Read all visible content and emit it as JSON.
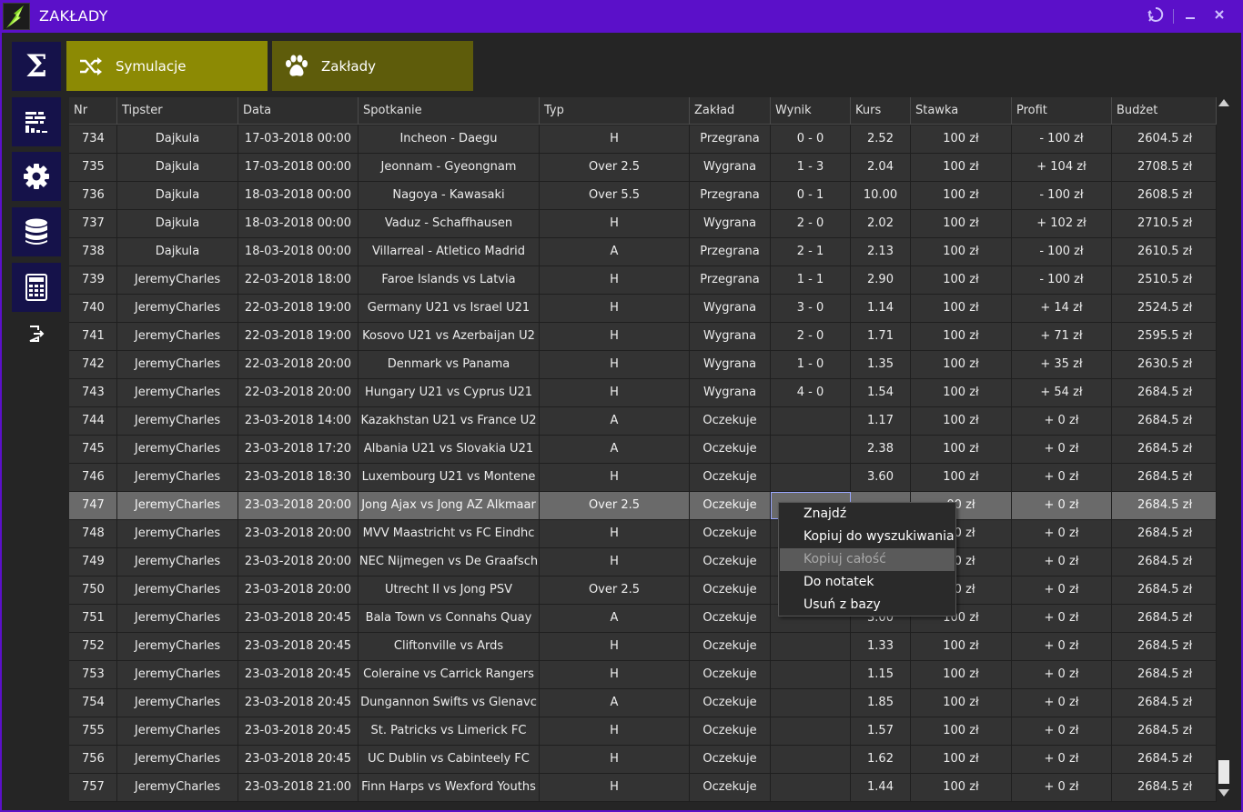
{
  "window": {
    "title": "ZAKŁADY"
  },
  "tabs": [
    {
      "label": "Symulacje",
      "icon": "shuffle-icon"
    },
    {
      "label": "Zakłady",
      "icon": "paw-icon"
    }
  ],
  "nav": [
    "sigma-icon",
    "stats-icon",
    "gear-icon",
    "database-icon",
    "calculator-icon",
    "logout-icon"
  ],
  "columns": [
    "Nr",
    "Tipster",
    "Data",
    "Spotkanie",
    "Typ",
    "Zakład",
    "Wynik",
    "Kurs",
    "Stawka",
    "Profit",
    "Budżet"
  ],
  "rows": [
    [
      "734",
      "Dajkula",
      "17-03-2018 00:00",
      "Incheon - Daegu",
      "H",
      "Przegrana",
      "0 - 0",
      "2.52",
      "100 zł",
      "- 100 zł",
      "2604.5 zł"
    ],
    [
      "735",
      "Dajkula",
      "17-03-2018 00:00",
      "Jeonnam - Gyeongnam",
      "Over 2.5",
      "Wygrana",
      "1 - 3",
      "2.04",
      "100 zł",
      "+ 104 zł",
      "2708.5 zł"
    ],
    [
      "736",
      "Dajkula",
      "18-03-2018 00:00",
      "Nagoya - Kawasaki",
      "Over 5.5",
      "Przegrana",
      "0 - 1",
      "10.00",
      "100 zł",
      "- 100 zł",
      "2608.5 zł"
    ],
    [
      "737",
      "Dajkula",
      "18-03-2018 00:00",
      "Vaduz - Schaffhausen",
      "H",
      "Wygrana",
      "2 - 0",
      "2.02",
      "100 zł",
      "+ 102 zł",
      "2710.5 zł"
    ],
    [
      "738",
      "Dajkula",
      "18-03-2018 00:00",
      "Villarreal - Atletico Madrid",
      "A",
      "Przegrana",
      "2 - 1",
      "2.13",
      "100 zł",
      "- 100 zł",
      "2610.5 zł"
    ],
    [
      "739",
      "JeremyCharles",
      "22-03-2018 18:00",
      "Faroe Islands vs Latvia",
      "H",
      "Przegrana",
      "1 - 1",
      "2.90",
      "100 zł",
      "- 100 zł",
      "2510.5 zł"
    ],
    [
      "740",
      "JeremyCharles",
      "22-03-2018 19:00",
      "Germany U21 vs Israel U21",
      "H",
      "Wygrana",
      "3 - 0",
      "1.14",
      "100 zł",
      "+ 14 zł",
      "2524.5 zł"
    ],
    [
      "741",
      "JeremyCharles",
      "22-03-2018 19:00",
      "Kosovo U21 vs Azerbaijan U2",
      "H",
      "Wygrana",
      "2 - 0",
      "1.71",
      "100 zł",
      "+ 71 zł",
      "2595.5 zł"
    ],
    [
      "742",
      "JeremyCharles",
      "22-03-2018 20:00",
      "Denmark vs Panama",
      "H",
      "Wygrana",
      "1 - 0",
      "1.35",
      "100 zł",
      "+ 35 zł",
      "2630.5 zł"
    ],
    [
      "743",
      "JeremyCharles",
      "22-03-2018 20:00",
      "Hungary U21 vs Cyprus U21",
      "H",
      "Wygrana",
      "4 - 0",
      "1.54",
      "100 zł",
      "+ 54 zł",
      "2684.5 zł"
    ],
    [
      "744",
      "JeremyCharles",
      "23-03-2018 14:00",
      "Kazakhstan U21 vs France U2",
      "A",
      "Oczekuje",
      "",
      "1.17",
      "100 zł",
      "+ 0 zł",
      "2684.5 zł"
    ],
    [
      "745",
      "JeremyCharles",
      "23-03-2018 17:20",
      "Albania U21 vs Slovakia U21",
      "A",
      "Oczekuje",
      "",
      "2.38",
      "100 zł",
      "+ 0 zł",
      "2684.5 zł"
    ],
    [
      "746",
      "JeremyCharles",
      "23-03-2018 18:30",
      "Luxembourg U21 vs Montene",
      "H",
      "Oczekuje",
      "",
      "3.60",
      "100 zł",
      "+ 0 zł",
      "2684.5 zł"
    ],
    [
      "747",
      "JeremyCharles",
      "23-03-2018 20:00",
      "Jong Ajax vs Jong AZ Alkmaar",
      "Over 2.5",
      "Oczekuje",
      "",
      "",
      "00 zł",
      "+ 0 zł",
      "2684.5 zł"
    ],
    [
      "748",
      "JeremyCharles",
      "23-03-2018 20:00",
      "MVV Maastricht vs FC Eindhc",
      "H",
      "Oczekuje",
      "",
      "",
      "00 zł",
      "+ 0 zł",
      "2684.5 zł"
    ],
    [
      "749",
      "JeremyCharles",
      "23-03-2018 20:00",
      "NEC Nijmegen vs De Graafsch",
      "H",
      "Oczekuje",
      "",
      "",
      "00 zł",
      "+ 0 zł",
      "2684.5 zł"
    ],
    [
      "750",
      "JeremyCharles",
      "23-03-2018 20:00",
      "Utrecht II vs Jong PSV",
      "Over 2.5",
      "Oczekuje",
      "",
      "",
      "00 zł",
      "+ 0 zł",
      "2684.5 zł"
    ],
    [
      "751",
      "JeremyCharles",
      "23-03-2018 20:45",
      "Bala Town vs Connahs Quay",
      "A",
      "Oczekuje",
      "",
      "3.00",
      "100 zł",
      "+ 0 zł",
      "2684.5 zł"
    ],
    [
      "752",
      "JeremyCharles",
      "23-03-2018 20:45",
      "Cliftonville vs Ards",
      "H",
      "Oczekuje",
      "",
      "1.33",
      "100 zł",
      "+ 0 zł",
      "2684.5 zł"
    ],
    [
      "753",
      "JeremyCharles",
      "23-03-2018 20:45",
      "Coleraine vs Carrick Rangers",
      "H",
      "Oczekuje",
      "",
      "1.15",
      "100 zł",
      "+ 0 zł",
      "2684.5 zł"
    ],
    [
      "754",
      "JeremyCharles",
      "23-03-2018 20:45",
      "Dungannon Swifts vs Glenavc",
      "A",
      "Oczekuje",
      "",
      "1.85",
      "100 zł",
      "+ 0 zł",
      "2684.5 zł"
    ],
    [
      "755",
      "JeremyCharles",
      "23-03-2018 20:45",
      "St. Patricks vs Limerick FC",
      "H",
      "Oczekuje",
      "",
      "1.57",
      "100 zł",
      "+ 0 zł",
      "2684.5 zł"
    ],
    [
      "756",
      "JeremyCharles",
      "23-03-2018 20:45",
      "UC Dublin vs Cabinteely FC",
      "H",
      "Oczekuje",
      "",
      "1.62",
      "100 zł",
      "+ 0 zł",
      "2684.5 zł"
    ],
    [
      "757",
      "JeremyCharles",
      "23-03-2018 21:00",
      "Finn Harps vs Wexford Youths",
      "H",
      "Oczekuje",
      "",
      "1.44",
      "100 zł",
      "+ 0 zł",
      "2684.5 zł"
    ]
  ],
  "selected_row": "747",
  "context_menu": {
    "items": [
      "Znajdź",
      "Kopiuj do wyszukiwania",
      "Kopiuj całość",
      "Do notatek",
      "Usuń z bazy"
    ],
    "hovered": "Kopiuj całość"
  },
  "colors": {
    "titlebar": "#5b10c9",
    "tab_active": "#8c8a04",
    "tab_inactive": "#5e5c0b",
    "nav_button": "#15124a"
  }
}
